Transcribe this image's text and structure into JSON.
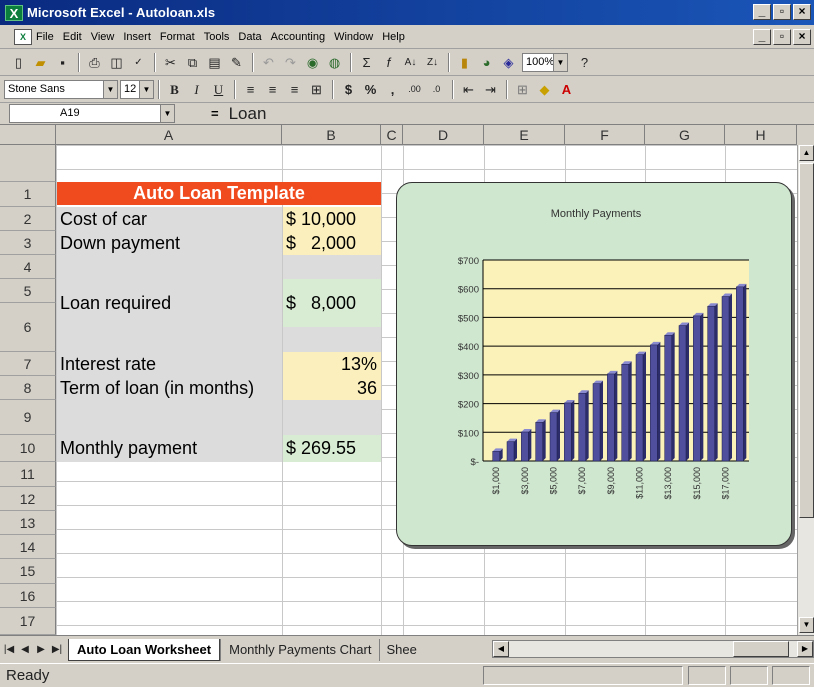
{
  "window": {
    "title": "Microsoft Excel - Autoloan.xls",
    "icon": "excel-icon",
    "buttons": [
      "_",
      "ð",
      "X"
    ]
  },
  "menu": {
    "items": [
      "File",
      "Edit",
      "View",
      "Insert",
      "Format",
      "Tools",
      "Data",
      "Accounting",
      "Window",
      "Help"
    ]
  },
  "format_toolbar": {
    "font": "Stone Sans",
    "size": "12",
    "zoom": "100%"
  },
  "formula_bar": {
    "name_box": "A19",
    "equals": "=",
    "value": "Loan"
  },
  "columns": [
    "A",
    "B",
    "C",
    "D",
    "E",
    "F",
    "G",
    "H"
  ],
  "rows": [
    "1",
    "2",
    "3",
    "4",
    "5",
    "6",
    "7",
    "8",
    "9",
    "10",
    "11",
    "12",
    "13",
    "14",
    "15",
    "16",
    "17"
  ],
  "sheet": {
    "title": "Auto Loan Template",
    "cost_label": "Cost of car",
    "cost_value": "$ 10,000",
    "down_label": "Down payment",
    "down_value": "$   2,000",
    "loan_label": "Loan required",
    "loan_value": "$   8,000",
    "rate_label": "Interest rate",
    "rate_value": "13%",
    "term_label": "Term of loan (in months)",
    "term_value": "36",
    "payment_label": "Monthly payment",
    "payment_value": "$ 269.55"
  },
  "chart_data": {
    "type": "bar",
    "title": "Monthly Payments",
    "xlabel": "",
    "ylabel": "",
    "ylim": [
      0,
      700
    ],
    "yticks": [
      "$-",
      "$100",
      "$200",
      "$300",
      "$400",
      "$500",
      "$600",
      "$700"
    ],
    "categories": [
      "$1,000",
      "$2,000",
      "$3,000",
      "$4,000",
      "$5,000",
      "$6,000",
      "$7,000",
      "$8,000",
      "$9,000",
      "$10,000",
      "$11,000",
      "$12,000",
      "$13,000",
      "$14,000",
      "$15,000",
      "$16,000",
      "$17,000",
      "$18,000"
    ],
    "xtick_labels": [
      "$1,000",
      "$3,000",
      "$5,000",
      "$7,000",
      "$9,000",
      "$11,000",
      "$13,000",
      "$15,000",
      "$17,000"
    ],
    "values": [
      33.69,
      67.39,
      101.08,
      134.78,
      168.47,
      202.16,
      235.86,
      269.55,
      303.24,
      336.94,
      370.63,
      404.33,
      438.02,
      471.71,
      505.41,
      539.1,
      572.8,
      606.49
    ],
    "plot_color": "#faf2b8",
    "bar_color": "#4f4f9e",
    "background": "#cfe6cf",
    "grid": true
  },
  "sheet_tabs": [
    "Auto Loan Worksheet",
    "Monthly Payments Chart",
    "Shee"
  ],
  "status": "Ready"
}
